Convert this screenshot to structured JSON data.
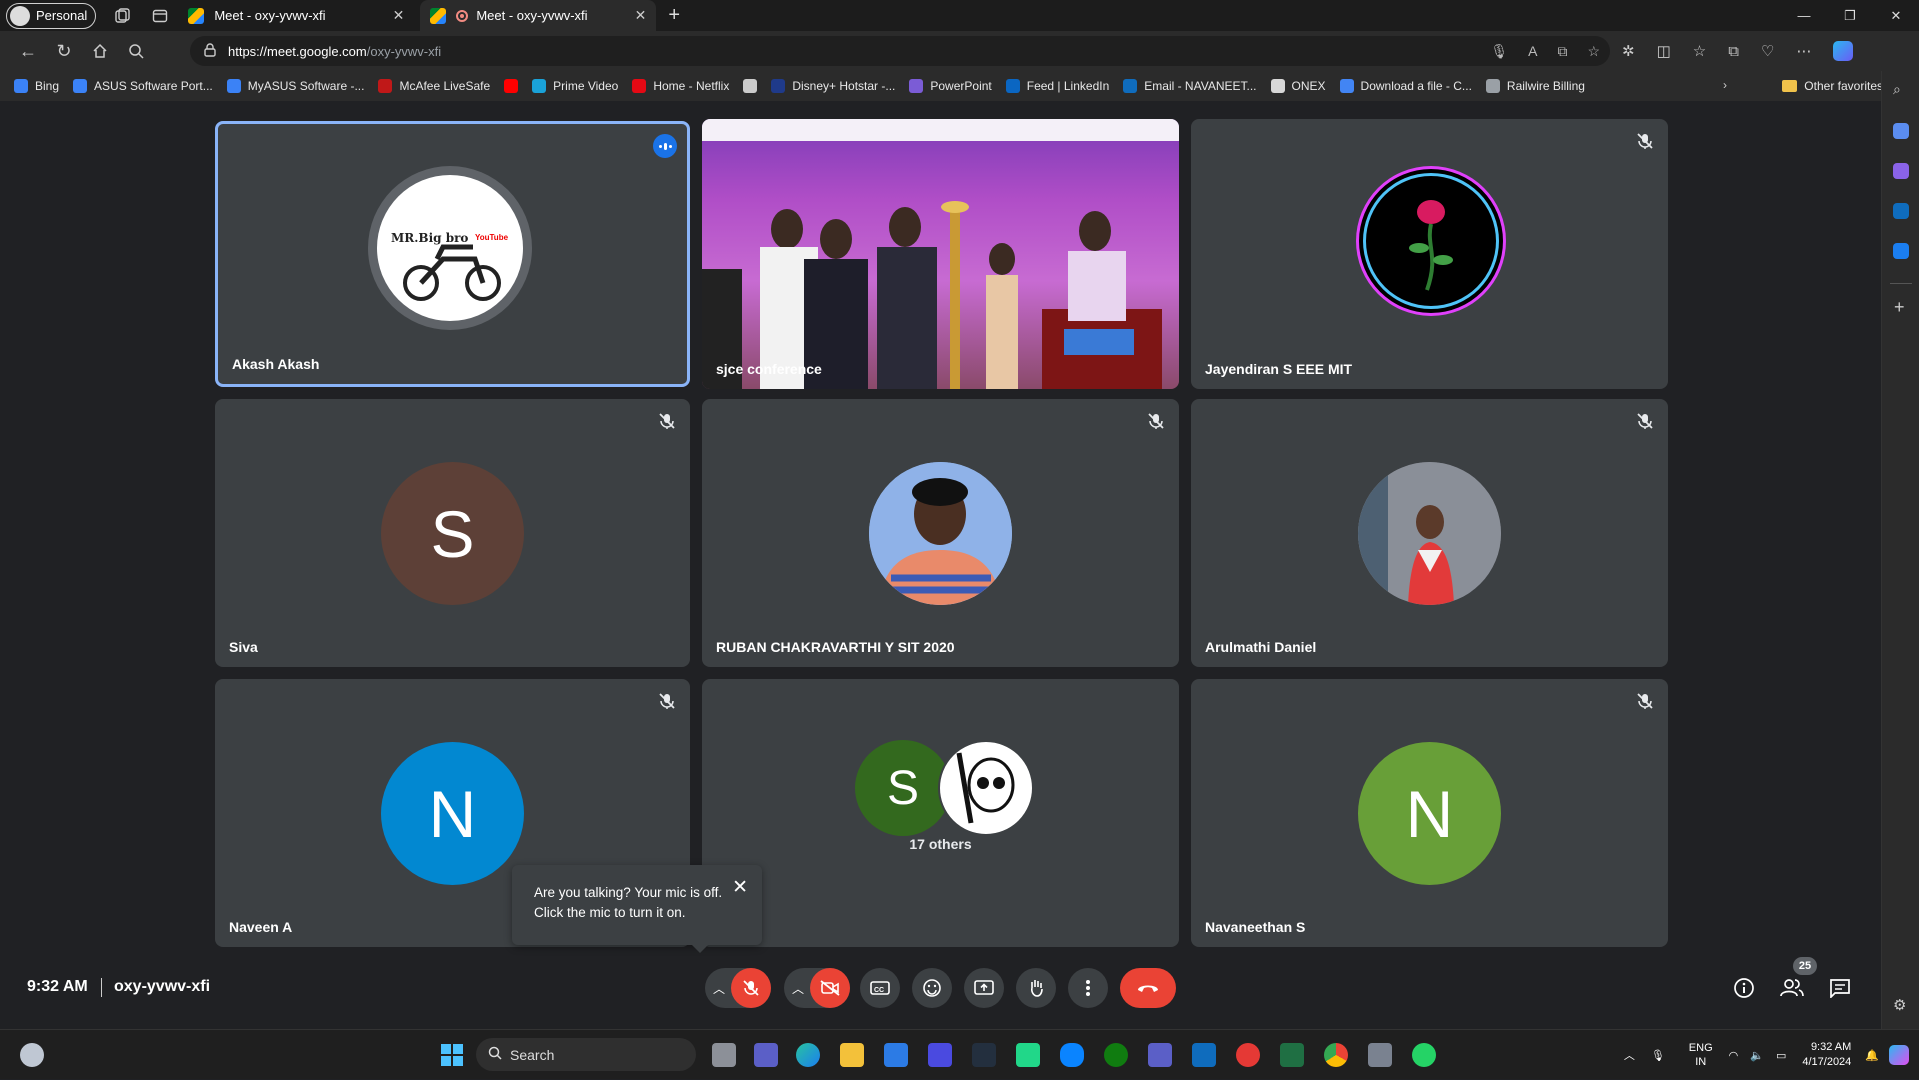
{
  "browser": {
    "profile_label": "Personal",
    "tabs": [
      {
        "title": "Meet - oxy-yvwv-xfi"
      },
      {
        "title": "Meet - oxy-yvwv-xfi"
      }
    ],
    "url_host": "https://meet.google.com",
    "url_path": "/oxy-yvwv-xfi",
    "favorites": [
      {
        "label": "Bing",
        "color": "#3b82f6"
      },
      {
        "label": "ASUS Software Port...",
        "color": "#3b82f6"
      },
      {
        "label": "MyASUS Software -...",
        "color": "#3b82f6"
      },
      {
        "label": "McAfee LiveSafe",
        "color": "#c01818"
      },
      {
        "label": "",
        "color": "#ff0000"
      },
      {
        "label": "Prime Video",
        "color": "#1aa2d8"
      },
      {
        "label": "Home - Netflix",
        "color": "#e50914"
      },
      {
        "label": "",
        "color": "#cccccc"
      },
      {
        "label": "Disney+ Hotstar -...",
        "color": "#1f3a8a"
      },
      {
        "label": "PowerPoint",
        "color": "#7b5cd6"
      },
      {
        "label": "Feed | LinkedIn",
        "color": "#0a66c2"
      },
      {
        "label": "Email - NAVANEET...",
        "color": "#0f6cbd"
      },
      {
        "label": "ONEX",
        "color": "#d7d7d7"
      },
      {
        "label": "Download a file - C...",
        "color": "#4285f4"
      },
      {
        "label": "Railwire Billing",
        "color": "#9aa0a6"
      }
    ],
    "other_favorites": "Other favorites"
  },
  "meet": {
    "participants": [
      {
        "name": "Akash Akash",
        "speaking": true
      },
      {
        "name": "sjce conference"
      },
      {
        "name": "Jayendiran S EEE MIT"
      },
      {
        "name": "Siva",
        "initial": "S",
        "color": "#5d4037"
      },
      {
        "name": "RUBAN CHAKRAVARTHI Y SIT 2020"
      },
      {
        "name": "Arulmathi Daniel"
      },
      {
        "name": "Naveen A",
        "initial": "N",
        "color": "#0288d1"
      },
      {
        "name": "Navaneethan S",
        "initial": "N",
        "color": "#689f38"
      }
    ],
    "others": {
      "label": "17 others",
      "initial": "S",
      "color": "#33691e"
    },
    "avatar_text": {
      "line1": "MR.Big bro",
      "line2": "YouTube"
    },
    "mic_tooltip": "Are you talking? Your mic is off. Click the mic to turn it on.",
    "time": "9:32 AM",
    "meeting_code": "oxy-yvwv-xfi",
    "people_count": "25"
  },
  "taskbar": {
    "search_label": "Search",
    "lang_line1": "ENG",
    "lang_line2": "IN",
    "clock_time": "9:32 AM",
    "clock_date": "4/17/2024"
  }
}
